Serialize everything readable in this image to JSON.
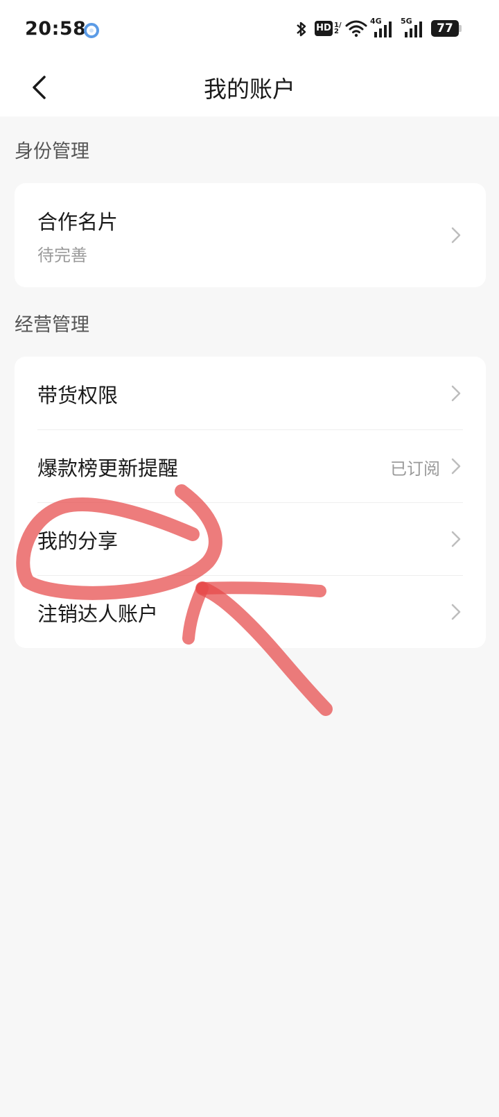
{
  "status_bar": {
    "time": "20:58",
    "hd_label": "HD",
    "sim_label": "1/2",
    "net_4g": "4G",
    "net_5g": "5G",
    "battery": "77",
    "icons": [
      "app-notification-icon",
      "bluetooth-icon",
      "hd-icon",
      "wifi-icon",
      "signal-4g-icon",
      "signal-5g-icon",
      "battery-icon"
    ]
  },
  "header": {
    "title": "我的账户",
    "back_icon": "chevron-left-icon"
  },
  "sections": {
    "identity": {
      "label": "身份管理",
      "items": [
        {
          "title": "合作名片",
          "subtitle": "待完善"
        }
      ]
    },
    "business": {
      "label": "经营管理",
      "items": [
        {
          "title": "带货权限"
        },
        {
          "title": "爆款榜更新提醒",
          "value": "已订阅"
        },
        {
          "title": "我的分享"
        },
        {
          "title": "注销达人账户"
        }
      ]
    }
  },
  "colors": {
    "background": "#f7f7f7",
    "card": "#ffffff",
    "annotation_stroke": "#e64a4a"
  }
}
